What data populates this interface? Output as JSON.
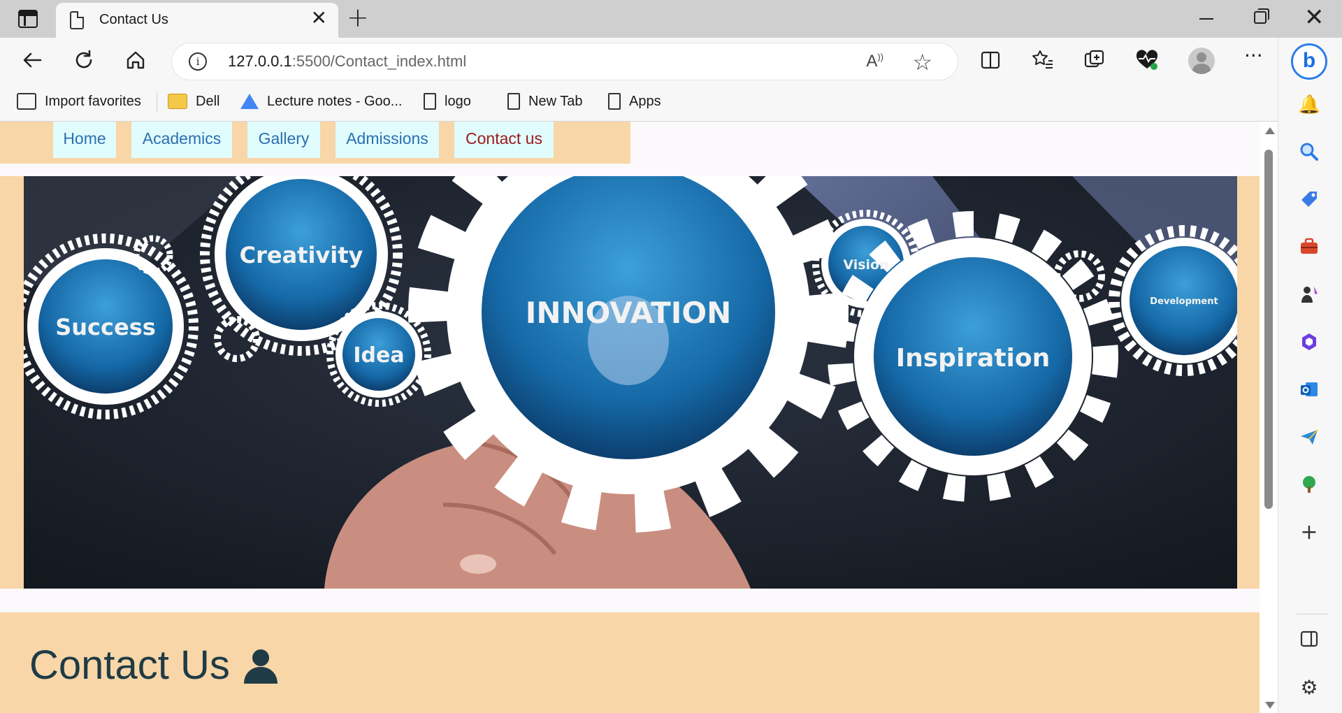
{
  "browser": {
    "tab_title": "Contact Us",
    "tab_close": "✕",
    "new_tab": "+",
    "url_host": "127.0.0.1",
    "url_rest": ":5500/Contact_index.html",
    "read_aloud": "Aͅ",
    "bookmarks": [
      {
        "label": "Import favorites",
        "icon": "import-icon"
      },
      {
        "label": "Dell",
        "icon": "folder-icon"
      },
      {
        "label": "Lecture notes - Goo...",
        "icon": "google-drive-icon"
      },
      {
        "label": "logo",
        "icon": "page-icon"
      },
      {
        "label": "New Tab",
        "icon": "page-icon"
      },
      {
        "label": "Apps",
        "icon": "page-icon"
      }
    ],
    "bing_label": "b"
  },
  "page": {
    "nav": [
      {
        "label": "Home",
        "active": false
      },
      {
        "label": "Academics",
        "active": false
      },
      {
        "label": "Gallery",
        "active": false
      },
      {
        "label": "Admissions",
        "active": false
      },
      {
        "label": "Contact us",
        "active": true
      }
    ],
    "banner": {
      "gears": [
        "Creativity",
        "Success",
        "Idea",
        "INNOVATION",
        "Vision",
        "Inspiration",
        "Development"
      ]
    },
    "contact_heading": "Contact Us",
    "colors": {
      "band": "#f8d6a7",
      "nav_item_bg": "#e0fcfd",
      "nav_link": "#2c6fb2",
      "nav_active": "#a01a1a",
      "heading": "#1f3b45"
    }
  }
}
